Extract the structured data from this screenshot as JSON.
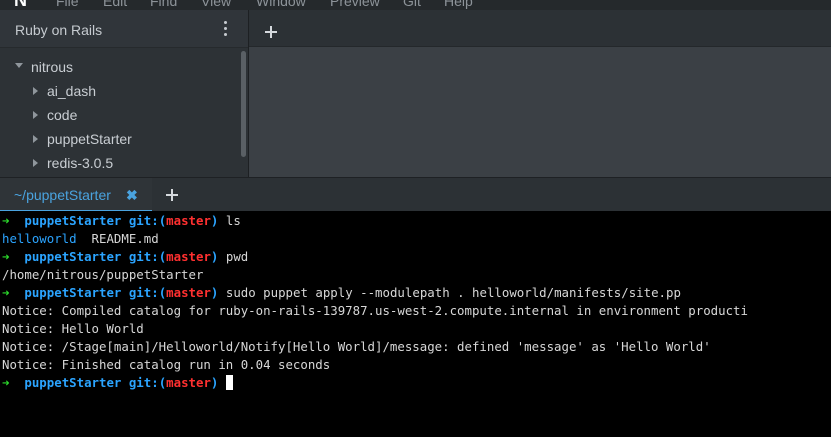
{
  "menubar": {
    "logo": "N",
    "items": [
      "File",
      "Edit",
      "Find",
      "View",
      "Window",
      "Preview",
      "Git",
      "Help"
    ]
  },
  "sidebar": {
    "title": "Ruby on Rails",
    "tree": [
      {
        "label": "nitrous",
        "expanded": true,
        "level": 0
      },
      {
        "label": "ai_dash",
        "expanded": false,
        "level": 1
      },
      {
        "label": "code",
        "expanded": false,
        "level": 1
      },
      {
        "label": "puppetStarter",
        "expanded": false,
        "level": 1
      },
      {
        "label": "redis-3.0.5",
        "expanded": false,
        "level": 1
      }
    ]
  },
  "terminal_tab": {
    "label": "~/puppetStarter",
    "close": "✖"
  },
  "prompt": {
    "arrow": "➜",
    "dir": "puppetStarter",
    "git": "git:",
    "branch_open": "(",
    "branch": "master",
    "branch_close": ")"
  },
  "terminal": {
    "cmd1": "ls",
    "ls_out1": "helloworld",
    "ls_out2": "README.md",
    "cmd2": "pwd",
    "pwd_out": "/home/nitrous/puppetStarter",
    "cmd3": "sudo puppet apply --modulepath . helloworld/manifests/site.pp",
    "out1": "Notice: Compiled catalog for ruby-on-rails-139787.us-west-2.compute.internal in environment producti",
    "out2": "Notice: Hello World",
    "out3": "Notice: /Stage[main]/Helloworld/Notify[Hello World]/message: defined 'message' as 'Hello World'",
    "out4": "Notice: Finished catalog run in 0.04 seconds"
  },
  "colors": {
    "accent": "#4aa3df",
    "prompt_arrow": "#2bd92b",
    "prompt_dir": "#2ba4ff",
    "branch": "#ff3030"
  }
}
